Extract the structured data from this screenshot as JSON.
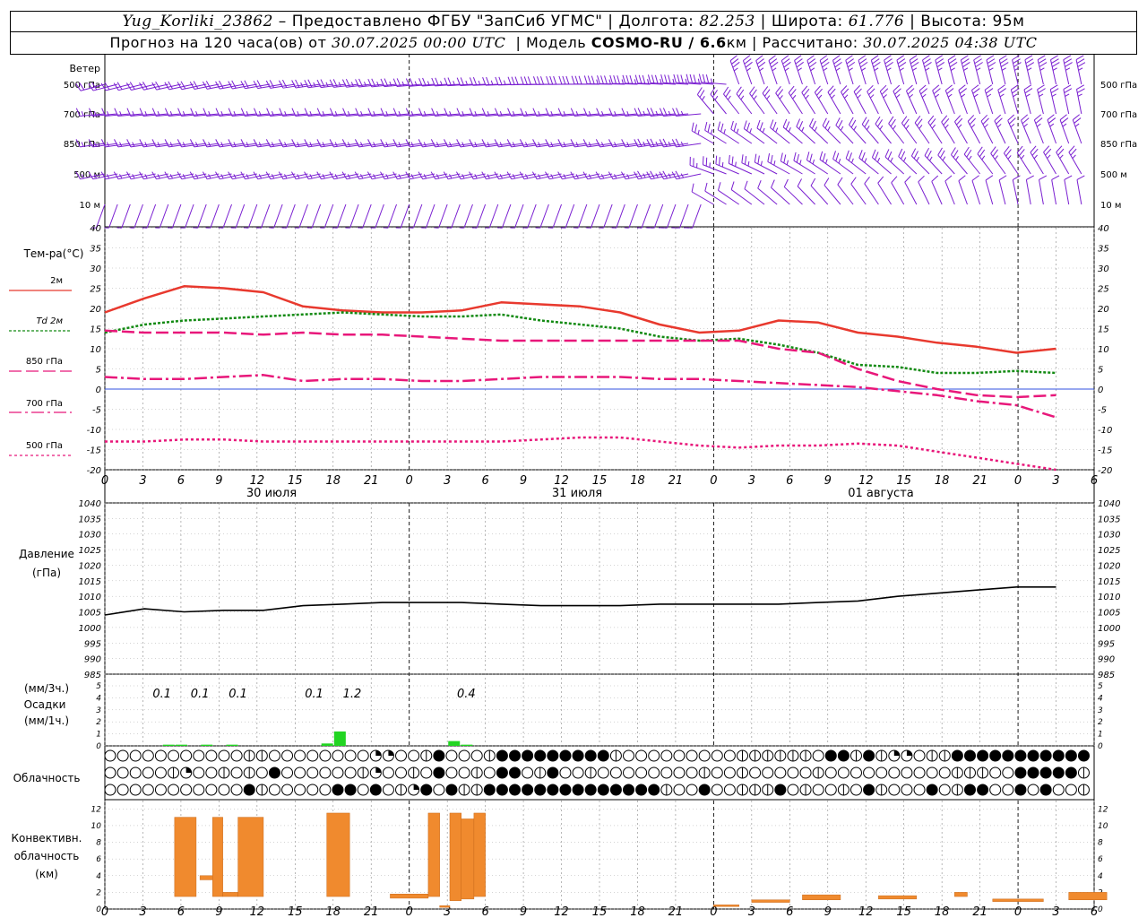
{
  "header": {
    "station": "Yug_Korliki_23862",
    "provider": "– Предоставлено ФГБУ \"ЗапСиб УГМС\"",
    "lon_label": "Долгота:",
    "lon": "82.253",
    "lat_label": "Широта:",
    "lat": "61.776",
    "alt_label": "Высота:",
    "alt": "95м",
    "forecast_prefix": "Прогноз на 120 часа(ов) от",
    "forecast_start": "30.07.2025 00:00 UTC",
    "model_label": "Модель",
    "model_name": "COSMO-RU / 6.6",
    "model_unit": "км",
    "calc_label": "Рассчитано:",
    "calc_time": "30.07.2025 04:38 UTC"
  },
  "wind_panel": {
    "title": "Ветер",
    "levels": [
      "500 гПа",
      "700 гПа",
      "850 гПа",
      "500 м",
      "10 м"
    ],
    "right_levels": [
      "500 гПа",
      "700 гПа",
      "850 гПа",
      "500 м",
      "10 м"
    ]
  },
  "temp_panel": {
    "title": "Тем-ра(°С)",
    "legend": [
      {
        "label": "2м",
        "color": "#e8392e",
        "dash": ""
      },
      {
        "label": "Td  2м",
        "color": "#138a13",
        "dash": "3,2"
      },
      {
        "label": "850 гПа",
        "color": "#e8177a",
        "dash": "14,5"
      },
      {
        "label": "700 гПа",
        "color": "#e8177a",
        "dash": "14,4,3,4"
      },
      {
        "label": "500 гПа",
        "color": "#e8177a",
        "dash": "3,3"
      }
    ]
  },
  "pressure_panel": {
    "title1": "Давление",
    "title2": "(гПа)"
  },
  "precip_panel": {
    "title1": "(мм/3ч.)",
    "title2": "Осадки",
    "title3": "(мм/1ч.)",
    "color": "#22d522"
  },
  "cloud_panel": {
    "title": "Облачность"
  },
  "conv_panel": {
    "title1": "Конвективн.",
    "title2": "облачность",
    "title3": "(км)",
    "color": "#f08a2e"
  },
  "time_axis": {
    "hour_labels": [
      "0",
      "3",
      "6",
      "9",
      "12",
      "15",
      "18",
      "21",
      "0",
      "3",
      "6",
      "9",
      "12",
      "15",
      "18",
      "21",
      "0",
      "3",
      "6",
      "9",
      "12",
      "15",
      "18",
      "21",
      "0",
      "3",
      "6"
    ],
    "day_labels": [
      "30 июля",
      "31 июля",
      "01 августа"
    ]
  },
  "chart_data": [
    {
      "type": "line",
      "title": "Тем-ра(°С)",
      "x_hours": [
        0,
        3,
        6,
        9,
        12,
        15,
        18,
        21,
        24,
        27,
        30,
        33,
        36,
        39,
        42,
        45,
        48,
        51,
        54,
        57,
        60,
        63,
        66,
        69,
        72
      ],
      "ylim": [
        -20,
        40
      ],
      "yticks": [
        -20,
        -15,
        -10,
        -5,
        0,
        5,
        10,
        15,
        20,
        25,
        30,
        35,
        40
      ],
      "series": [
        {
          "name": "2м",
          "values": [
            19,
            22.5,
            25.5,
            25,
            24,
            20.5,
            19.5,
            19,
            19,
            19.5,
            21.5,
            21,
            20.5,
            19,
            16,
            14,
            14.5,
            17,
            16.5,
            14,
            13,
            11.5,
            10.5,
            9,
            10
          ]
        },
        {
          "name": "Td  2м",
          "values": [
            14,
            16,
            17,
            17.5,
            18,
            18.5,
            19,
            18.5,
            18,
            18,
            18.5,
            17,
            16,
            15,
            13,
            12,
            12.5,
            11,
            9,
            6,
            5.5,
            4,
            4,
            4.5,
            4
          ]
        },
        {
          "name": "850 гПа",
          "values": [
            14.5,
            14,
            14,
            14,
            13.5,
            14,
            13.5,
            13.5,
            13,
            12.5,
            12,
            12,
            12,
            12,
            12,
            12,
            12,
            10,
            9,
            5,
            2,
            0,
            -1.5,
            -2,
            -1.5
          ]
        },
        {
          "name": "700 гПа",
          "values": [
            3,
            2.5,
            2.5,
            3,
            3.5,
            2,
            2.5,
            2.5,
            2,
            2,
            2.5,
            3,
            3,
            3,
            2.5,
            2.5,
            2,
            1.5,
            1,
            0.5,
            -0.5,
            -1.5,
            -3,
            -4,
            -7
          ]
        },
        {
          "name": "500 гПа",
          "values": [
            -13,
            -13,
            -12.5,
            -12.5,
            -13,
            -13,
            -13,
            -13,
            -13,
            -13,
            -13,
            -12.5,
            -12,
            -12,
            -13,
            -14,
            -14.5,
            -14,
            -14,
            -13.5,
            -14,
            -15.5,
            -17,
            -18.5,
            -20
          ]
        }
      ]
    },
    {
      "type": "line",
      "title": "Давление (гПа)",
      "x_hours": [
        0,
        3,
        6,
        9,
        12,
        15,
        18,
        21,
        24,
        27,
        30,
        33,
        36,
        39,
        42,
        45,
        48,
        51,
        54,
        57,
        60,
        63,
        66,
        69,
        72
      ],
      "ylim": [
        985,
        1040
      ],
      "yticks": [
        985,
        990,
        995,
        1000,
        1005,
        1010,
        1015,
        1020,
        1025,
        1030,
        1035,
        1040
      ],
      "series": [
        {
          "name": "",
          "values": [
            1004,
            1006,
            1005,
            1005.5,
            1005.5,
            1007,
            1007.5,
            1008,
            1008,
            1008,
            1007.5,
            1007,
            1007,
            1007,
            1007.5,
            1007.5,
            1007.5,
            1007.5,
            1008,
            1008.5,
            1010,
            1011,
            1012,
            1013,
            1013
          ]
        }
      ]
    },
    {
      "type": "bar",
      "title": "Осадки (мм/1ч.)",
      "ylim": [
        0,
        5
      ],
      "yticks": [
        0,
        1,
        2,
        3,
        4,
        5
      ],
      "bars": [
        {
          "x": 5,
          "value": 0.1
        },
        {
          "x": 6,
          "value": 0.1
        },
        {
          "x": 8,
          "value": 0.1
        },
        {
          "x": 10,
          "value": 0.1
        },
        {
          "x": 17.5,
          "value": 0.2
        },
        {
          "x": 18.5,
          "value": 1.2
        },
        {
          "x": 27.5,
          "value": 0.4
        },
        {
          "x": 28.5,
          "value": 0.1
        }
      ],
      "labels_3h": [
        {
          "x": 4.5,
          "text": "0.1"
        },
        {
          "x": 7.5,
          "text": "0.1"
        },
        {
          "x": 10.5,
          "text": "0.1"
        },
        {
          "x": 16.5,
          "text": "0.1"
        },
        {
          "x": 19.5,
          "text": "1.2"
        },
        {
          "x": 28.5,
          "text": "0.4"
        }
      ]
    },
    {
      "type": "bar",
      "title": "Конвективн. облачность (км)",
      "ylim": [
        0,
        13
      ],
      "yticks": [
        0,
        2,
        4,
        6,
        8,
        10,
        12
      ],
      "bars": [
        {
          "x0": 5.5,
          "x1": 7.2,
          "bottom": 1.5,
          "top": 11
        },
        {
          "x0": 7.5,
          "x1": 8.5,
          "bottom": 3.5,
          "top": 4
        },
        {
          "x0": 8.5,
          "x1": 9.3,
          "bottom": 1.5,
          "top": 11
        },
        {
          "x0": 9.3,
          "x1": 10.5,
          "bottom": 1.5,
          "top": 2
        },
        {
          "x0": 10.5,
          "x1": 12.5,
          "bottom": 1.5,
          "top": 11
        },
        {
          "x0": 17.5,
          "x1": 19.3,
          "bottom": 1.5,
          "top": 11.5
        },
        {
          "x0": 22.5,
          "x1": 25.5,
          "bottom": 1.3,
          "top": 1.8
        },
        {
          "x0": 25.5,
          "x1": 26.4,
          "bottom": 1.5,
          "top": 11.5
        },
        {
          "x0": 26.4,
          "x1": 27.2,
          "bottom": 0.2,
          "top": 0.4
        },
        {
          "x0": 27.2,
          "x1": 28.1,
          "bottom": 1,
          "top": 11.5
        },
        {
          "x0": 28.1,
          "x1": 29.1,
          "bottom": 1.2,
          "top": 10.8
        },
        {
          "x0": 29.1,
          "x1": 30,
          "bottom": 1.5,
          "top": 11.5
        },
        {
          "x0": 48,
          "x1": 50,
          "bottom": 0.3,
          "top": 0.5
        },
        {
          "x0": 51,
          "x1": 54,
          "bottom": 0.8,
          "top": 1.1
        },
        {
          "x0": 55,
          "x1": 58,
          "bottom": 1.1,
          "top": 1.7
        },
        {
          "x0": 61,
          "x1": 64,
          "bottom": 1.2,
          "top": 1.6
        },
        {
          "x0": 67,
          "x1": 68,
          "bottom": 1.5,
          "top": 2
        },
        {
          "x0": 70,
          "x1": 74,
          "bottom": 0.9,
          "top": 1.2
        },
        {
          "x0": 76,
          "x1": 79,
          "bottom": 1.1,
          "top": 2
        }
      ]
    }
  ],
  "clouds": {
    "rows": 3,
    "row_codes": [
      "000000000001100000000220013000133333333310000000001111110331312201133333333333312100000000000000000000000000000000",
      "000001200101030000001200103001033013001000000001001000001000000000011100333331101133331200000000000000000000000000",
      "000000000003100000330301230311333333333333331003001113010010310003013300303001201103011030112300012002110312130330"
    ]
  },
  "wind_barbs": {
    "description": "speeds in knots at 1h steps for each level",
    "levels": [
      {
        "dir": [
          250,
          250,
          250,
          250,
          255,
          255,
          255,
          255,
          255,
          255,
          260,
          260,
          260,
          265,
          265,
          270,
          270,
          270,
          270,
          270,
          270,
          270,
          275,
          275,
          275,
          275,
          275,
          275,
          275,
          275,
          280,
          280,
          280,
          280,
          280,
          280,
          280,
          280,
          280,
          280,
          285,
          285,
          285,
          290,
          290,
          300,
          310,
          320,
          330,
          340,
          340,
          345,
          350,
          350,
          350,
          350,
          350,
          350,
          350,
          350,
          350,
          350,
          350,
          350,
          350,
          350,
          350,
          350,
          350,
          350,
          350,
          350,
          350,
          350,
          350,
          350,
          350,
          350,
          350,
          350,
          350,
          350,
          350,
          350,
          350,
          350,
          350,
          350,
          350,
          350,
          350,
          350,
          350,
          350,
          350,
          350,
          350,
          350,
          350,
          350,
          350,
          350,
          350,
          350,
          350,
          350,
          350,
          350,
          350,
          350,
          350,
          350,
          350,
          350
        ],
        "spd": 35
      },
      {
        "dir": 260,
        "spd": 20
      },
      {
        "dir": 260,
        "spd": 20
      },
      {
        "dir": 250,
        "spd": 18
      },
      {
        "dir": 200,
        "spd": 8
      }
    ]
  }
}
